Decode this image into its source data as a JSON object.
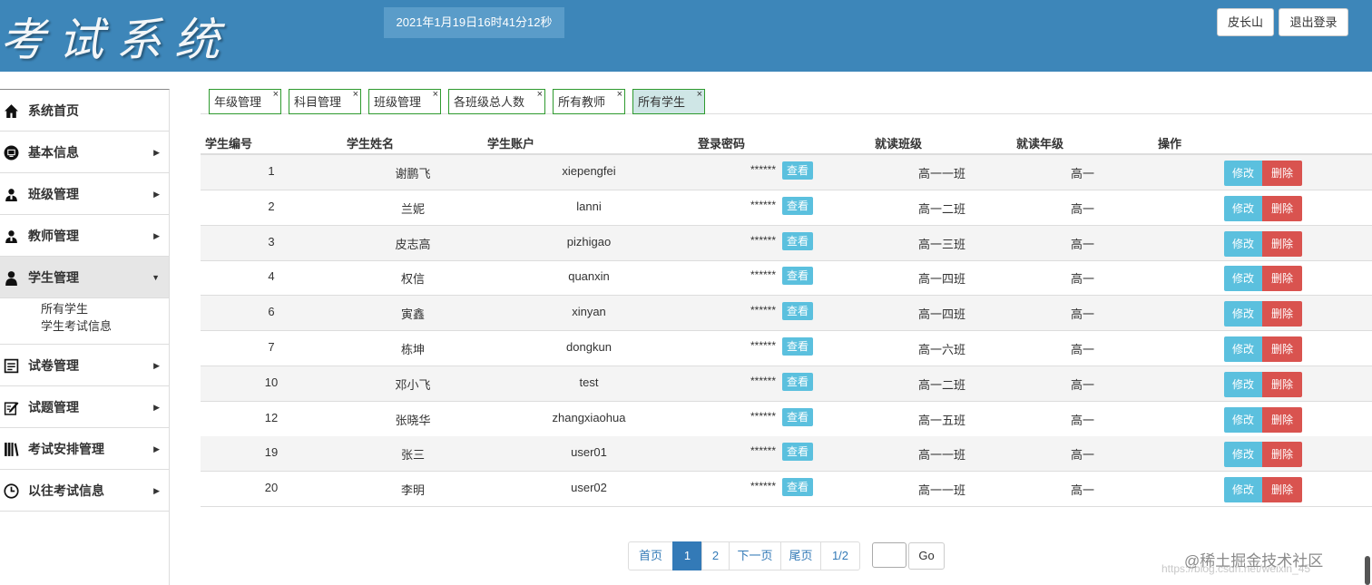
{
  "header": {
    "logo_text": "考试系统",
    "datetime": "2021年1月19日16时41分12秒",
    "user_button": "皮长山",
    "logout_button": "退出登录"
  },
  "sidebar": {
    "items": [
      {
        "label": "系统首页",
        "icon": "home-icon",
        "has_caret": false
      },
      {
        "label": "基本信息",
        "icon": "monitor-icon",
        "has_caret": true
      },
      {
        "label": "班级管理",
        "icon": "users-icon",
        "has_caret": true
      },
      {
        "label": "教师管理",
        "icon": "users-icon",
        "has_caret": true
      },
      {
        "label": "学生管理",
        "icon": "user-icon",
        "has_caret": true,
        "expanded": true
      },
      {
        "label": "试卷管理",
        "icon": "document-icon",
        "has_caret": true
      },
      {
        "label": "试题管理",
        "icon": "edit-icon",
        "has_caret": true
      },
      {
        "label": "考试安排管理",
        "icon": "books-icon",
        "has_caret": true
      },
      {
        "label": "以往考试信息",
        "icon": "clock-icon",
        "has_caret": true
      }
    ],
    "student_subitems": [
      "所有学生",
      "学生考试信息"
    ]
  },
  "tabs": [
    {
      "label": "年级管理",
      "close": "×"
    },
    {
      "label": "科目管理",
      "close": "×"
    },
    {
      "label": "班级管理",
      "close": "×"
    },
    {
      "label": "各班级总人数",
      "close": "×"
    },
    {
      "label": "所有教师",
      "close": "×"
    },
    {
      "label": "所有学生",
      "close": "×",
      "active": true
    }
  ],
  "table": {
    "headers": [
      "学生编号",
      "学生姓名",
      "学生账户",
      "登录密码",
      "就读班级",
      "就读年级",
      "操作"
    ],
    "password_mask": "******",
    "view_label": "查看",
    "edit_label": "修改",
    "delete_label": "删除",
    "rows": [
      {
        "id": "1",
        "name": "谢鹏飞",
        "account": "xiepengfei",
        "class": "高一一班",
        "grade": "高一"
      },
      {
        "id": "2",
        "name": "兰妮",
        "account": "lanni",
        "class": "高一二班",
        "grade": "高一"
      },
      {
        "id": "3",
        "name": "皮志高",
        "account": "pizhigao",
        "class": "高一三班",
        "grade": "高一"
      },
      {
        "id": "4",
        "name": "权信",
        "account": "quanxin",
        "class": "高一四班",
        "grade": "高一"
      },
      {
        "id": "6",
        "name": "寅鑫",
        "account": "xinyan",
        "class": "高一四班",
        "grade": "高一"
      },
      {
        "id": "7",
        "name": "栋坤",
        "account": "dongkun",
        "class": "高一六班",
        "grade": "高一"
      },
      {
        "id": "10",
        "name": "邓小飞",
        "account": "test",
        "class": "高一二班",
        "grade": "高一"
      },
      {
        "id": "12",
        "name": "张晓华",
        "account": "zhangxiaohua",
        "class": "高一五班",
        "grade": "高一"
      },
      {
        "id": "19",
        "name": "张三",
        "account": "user01",
        "class": "高一一班",
        "grade": "高一"
      },
      {
        "id": "20",
        "name": "李明",
        "account": "user02",
        "class": "高一一班",
        "grade": "高一"
      }
    ]
  },
  "pagination": {
    "first": "首页",
    "pages": [
      "1",
      "2"
    ],
    "current": "1",
    "next": "下一页",
    "last": "尾页",
    "page_info": "1/2",
    "go_label": "Go",
    "jump_value": ""
  },
  "watermark": {
    "brand": "@稀土掘金技术社区",
    "url": "https://blog.csdn.net/weixin_45"
  },
  "colors": {
    "header_bg": "#3d86b9",
    "tab_border": "#2e9a2e",
    "view_button": "#5bc0de",
    "delete_button": "#d9534f",
    "pagination_active": "#337ab7"
  }
}
